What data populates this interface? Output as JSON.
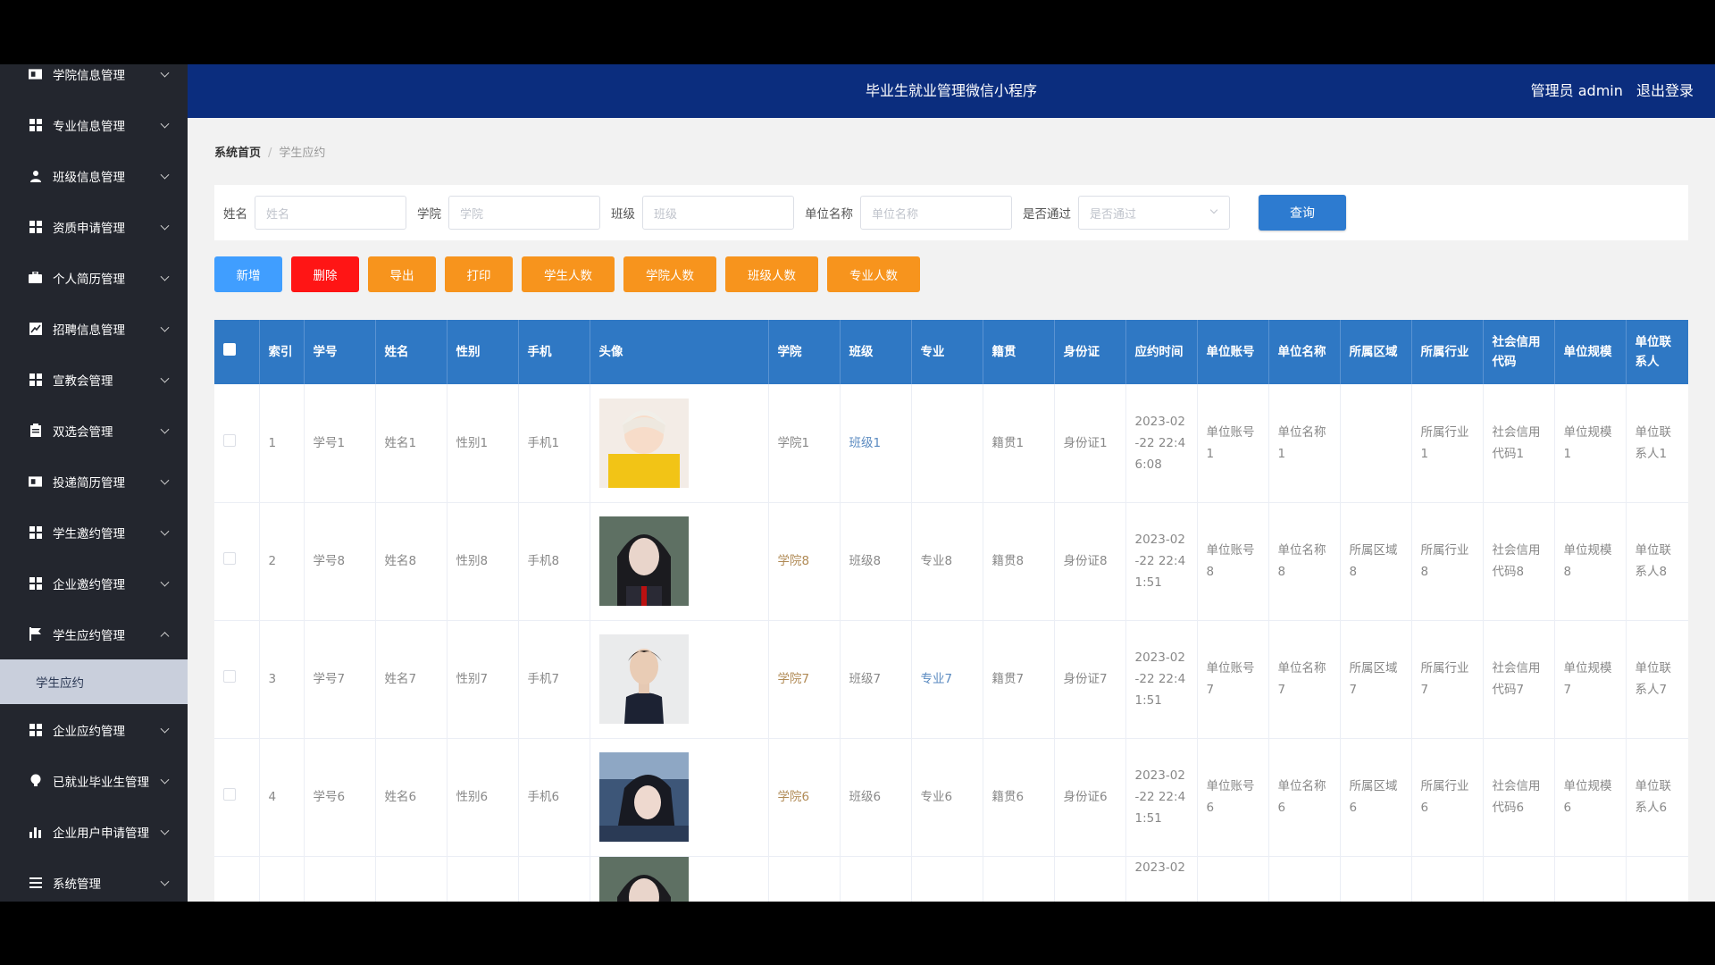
{
  "app": {
    "title": "毕业生就业管理微信小程序",
    "user": "管理员 admin",
    "logout": "退出登录"
  },
  "sidebar": {
    "items": [
      {
        "label": "学院信息管理",
        "icon": "id-card-icon"
      },
      {
        "label": "专业信息管理",
        "icon": "grid-icon"
      },
      {
        "label": "班级信息管理",
        "icon": "user-icon"
      },
      {
        "label": "资质申请管理",
        "icon": "grid-icon"
      },
      {
        "label": "个人简历管理",
        "icon": "briefcase-icon"
      },
      {
        "label": "招聘信息管理",
        "icon": "chart-icon"
      },
      {
        "label": "宣教会管理",
        "icon": "grid-icon"
      },
      {
        "label": "双选会管理",
        "icon": "clipboard-icon"
      },
      {
        "label": "投递简历管理",
        "icon": "id-card-icon"
      },
      {
        "label": "学生邀约管理",
        "icon": "grid-icon"
      },
      {
        "label": "企业邀约管理",
        "icon": "grid-icon"
      },
      {
        "label": "学生应约管理",
        "icon": "flag-icon"
      },
      {
        "label": "企业应约管理",
        "icon": "grid-icon"
      },
      {
        "label": "已就业毕业生管理",
        "icon": "bulb-icon"
      },
      {
        "label": "企业用户申请管理",
        "icon": "bar-chart-icon"
      },
      {
        "label": "系统管理",
        "icon": "menu-icon"
      }
    ],
    "active_sub": "学生应约"
  },
  "breadcrumb": {
    "home": "系统首页",
    "current": "学生应约"
  },
  "search": {
    "name_label": "姓名",
    "name_ph": "姓名",
    "college_label": "学院",
    "college_ph": "学院",
    "class_label": "班级",
    "class_ph": "班级",
    "unit_label": "单位名称",
    "unit_ph": "单位名称",
    "pass_label": "是否通过",
    "pass_ph": "是否通过",
    "query": "查询"
  },
  "actions": {
    "add": "新增",
    "delete": "删除",
    "export": "导出",
    "print": "打印",
    "stu_count": "学生人数",
    "college_count": "学院人数",
    "class_count": "班级人数",
    "major_count": "专业人数"
  },
  "colors": {
    "add": "#409eff",
    "delete": "#ff1515",
    "orange": "#f7941d",
    "header": "#0b2d7e",
    "thead": "#2f78c4",
    "sidebar": "#23262e"
  },
  "table": {
    "headers": [
      "索引",
      "学号",
      "姓名",
      "性别",
      "手机",
      "头像",
      "学院",
      "班级",
      "专业",
      "籍贯",
      "身份证",
      "应约时间",
      "单位账号",
      "单位名称",
      "所属区域",
      "所属行业",
      "社会信用代码",
      "单位规模",
      "单位联系人"
    ],
    "rows": [
      {
        "idx": "1",
        "sno": "学号1",
        "name": "姓名1",
        "sex": "性别1",
        "phone": "手机1",
        "avatar": "avatar-yellow",
        "college": "学院1",
        "cls": "班级1",
        "major": "",
        "native": "籍贯1",
        "idcard": "身份证1",
        "time": "2023-02-22 22:46:08",
        "acct": "单位账号1",
        "uname": "单位名称1",
        "region": "",
        "industry": "所属行业1",
        "credit": "社会信用代码1",
        "scale": "单位规模1",
        "contact": "单位联系人1"
      },
      {
        "idx": "2",
        "sno": "学号8",
        "name": "姓名8",
        "sex": "性别8",
        "phone": "手机8",
        "avatar": "avatar-dark",
        "college": "学院8",
        "cls": "班级8",
        "major": "专业8",
        "native": "籍贯8",
        "idcard": "身份证8",
        "time": "2023-02-22 22:41:51",
        "acct": "单位账号8",
        "uname": "单位名称8",
        "region": "所属区域8",
        "industry": "所属行业8",
        "credit": "社会信用代码8",
        "scale": "单位规模8",
        "contact": "单位联系人8"
      },
      {
        "idx": "3",
        "sno": "学号7",
        "name": "姓名7",
        "sex": "性别7",
        "phone": "手机7",
        "avatar": "avatar-tank",
        "college": "学院7",
        "cls": "班级7",
        "major": "专业7",
        "native": "籍贯7",
        "idcard": "身份证7",
        "time": "2023-02-22 22:41:51",
        "acct": "单位账号7",
        "uname": "单位名称7",
        "region": "所属区域7",
        "industry": "所属行业7",
        "credit": "社会信用代码7",
        "scale": "单位规模7",
        "contact": "单位联系人7"
      },
      {
        "idx": "4",
        "sno": "学号6",
        "name": "姓名6",
        "sex": "性别6",
        "phone": "手机6",
        "avatar": "avatar-blue",
        "college": "学院6",
        "cls": "班级6",
        "major": "专业6",
        "native": "籍贯6",
        "idcard": "身份证6",
        "time": "2023-02-22 22:41:51",
        "acct": "单位账号6",
        "uname": "单位名称6",
        "region": "所属区域6",
        "industry": "所属行业6",
        "credit": "社会信用代码6",
        "scale": "单位规模6",
        "contact": "单位联系人6"
      },
      {
        "idx": "",
        "sno": "",
        "name": "",
        "sex": "",
        "phone": "",
        "avatar": "avatar-dark",
        "college": "",
        "cls": "",
        "major": "",
        "native": "",
        "idcard": "",
        "time": "2023-02",
        "acct": "",
        "uname": "",
        "region": "",
        "industry": "",
        "credit": "",
        "scale": "",
        "contact": ""
      }
    ]
  }
}
